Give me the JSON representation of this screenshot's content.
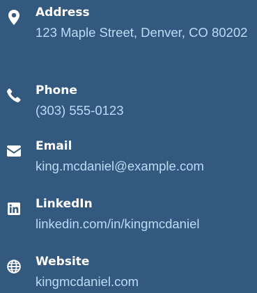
{
  "contact": {
    "address": {
      "icon": "map-marker-icon",
      "label": "Address",
      "value": "123 Maple Street, Denver, CO 80202"
    },
    "phone": {
      "icon": "phone-icon",
      "label": "Phone",
      "value": "(303) 555-0123"
    },
    "email": {
      "icon": "envelope-icon",
      "label": "Email",
      "value": "king.mcdaniel@example.com"
    },
    "linkedin": {
      "icon": "linkedin-icon",
      "label": "LinkedIn",
      "value": "linkedin.com/in/kingmcdaniel"
    },
    "website": {
      "icon": "globe-icon",
      "label": "Website",
      "value": "kingmcdaniel.com"
    }
  },
  "colors": {
    "background": "#34597f",
    "label": "#ffffff",
    "value": "#b9ddf7",
    "icon": "#ffffff"
  }
}
